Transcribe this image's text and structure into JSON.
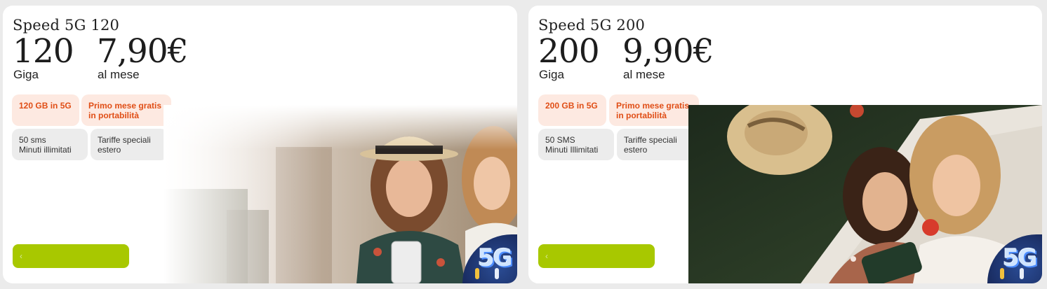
{
  "offers": [
    {
      "name": "Speed 5G 120",
      "giga_value": "120",
      "giga_label": "Giga",
      "price": "7,90€",
      "price_period": "al mese",
      "highlight_chips": [
        {
          "lines": [
            "120 GB in 5G"
          ]
        },
        {
          "lines": [
            "Primo mese gratis",
            "in portabilità"
          ]
        }
      ],
      "info_chips": [
        {
          "lines": [
            "50 sms",
            "Minuti illimitati"
          ]
        },
        {
          "lines": [
            "Tariffe speciali",
            "estero"
          ]
        }
      ],
      "cta_label": "‹",
      "badge_text": "5G",
      "photo_alt": "icon-photo-friends-cafe"
    },
    {
      "name": "Speed 5G 200",
      "giga_value": "200",
      "giga_label": "Giga",
      "price": "9,90€",
      "price_period": "al mese",
      "highlight_chips": [
        {
          "lines": [
            "200 GB in 5G"
          ]
        },
        {
          "lines": [
            "Primo mese gratis",
            "in portabilità"
          ]
        }
      ],
      "info_chips": [
        {
          "lines": [
            "50 SMS",
            "Minuti Illimitati"
          ]
        },
        {
          "lines": [
            "Tariffe speciali",
            "estero"
          ]
        }
      ],
      "cta_label": "‹",
      "badge_text": "5G",
      "photo_alt": "icon-photo-friends-picnic"
    }
  ],
  "colors": {
    "cta": "#a8c800",
    "highlight_bg": "#fde9e1",
    "highlight_text": "#e04e16",
    "info_bg": "#ececec",
    "badge_bg": "#1b2f66"
  }
}
